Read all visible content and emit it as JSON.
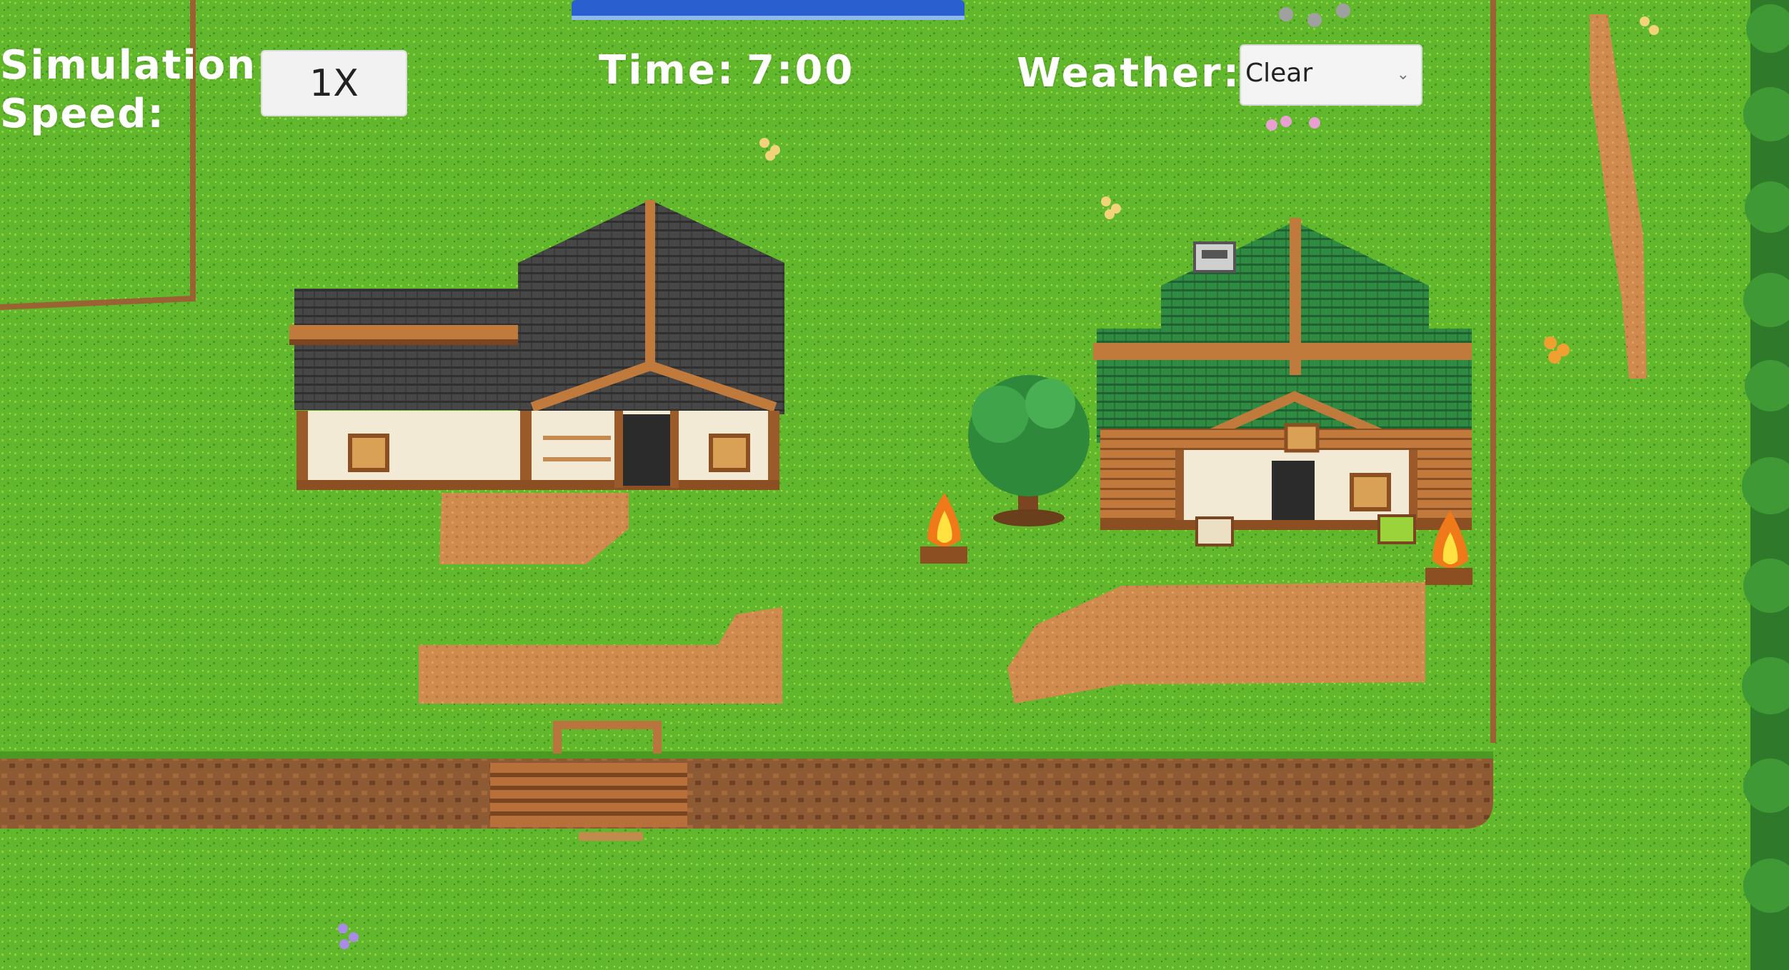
{
  "hud": {
    "speed_label": "Simulation Speed:",
    "speed_value": "1X",
    "time_label": "Time:",
    "time_value": "7:00",
    "weather_label": "Weather:",
    "weather_value": "Clear",
    "weather_chevron": "⌄"
  },
  "scene": {
    "houses": [
      {
        "roof": "dark gray"
      },
      {
        "roof": "green"
      }
    ],
    "campfires": 2,
    "trees": 1
  },
  "colors": {
    "grass": "#5fb62a",
    "grass_dark": "#3f8e1f",
    "dirt": "#c8834a",
    "cliff": "#8a5130",
    "water": "#2a5fd0",
    "roof_dark": "#3c3c3c",
    "roof_green": "#2e7a3a",
    "wall": "#f3ead6",
    "wood": "#b0652f"
  }
}
